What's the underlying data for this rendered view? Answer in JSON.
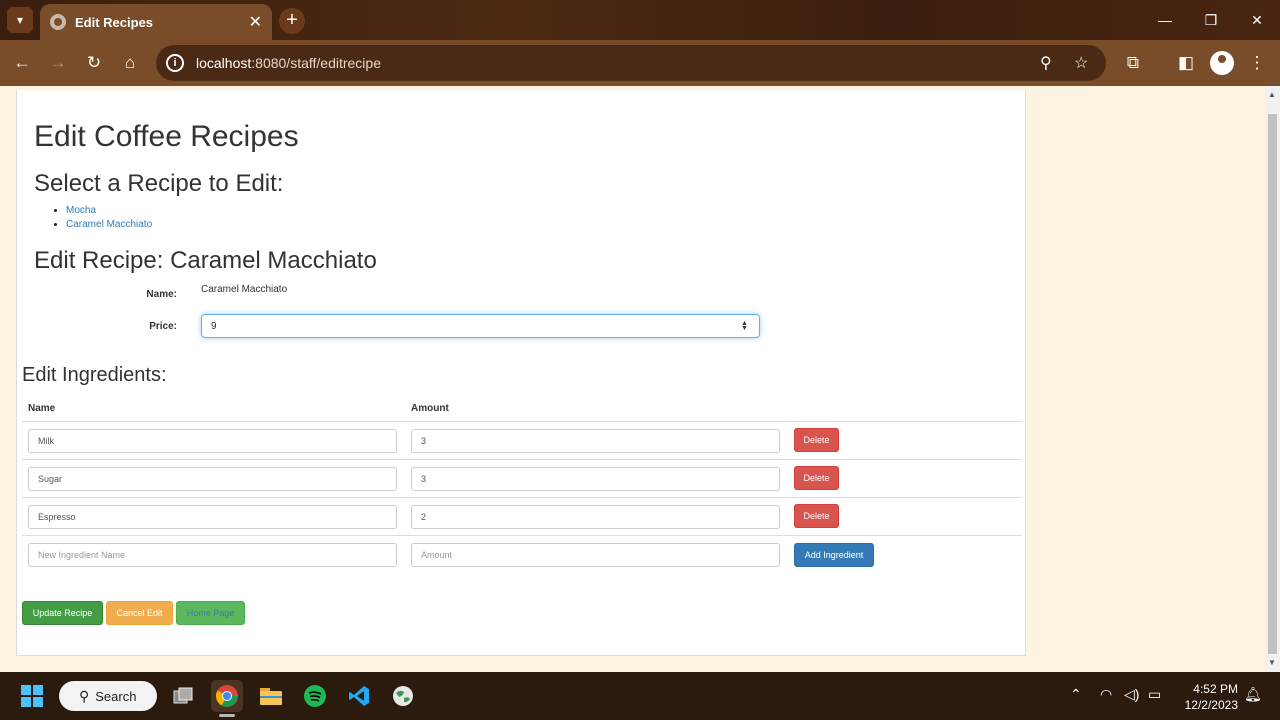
{
  "browser": {
    "tab_title": "Edit Recipes",
    "tab_close": "✕",
    "new_tab": "+",
    "url_host": "localhost",
    "url_path": ":8080/staff/editrecipe",
    "window_controls": {
      "minimize": "—",
      "restore": "❐",
      "close": "✕"
    }
  },
  "page": {
    "title": "Edit Coffee Recipes",
    "select_heading": "Select a Recipe to Edit:",
    "recipes": [
      "Mocha",
      "Caramel Macchiato"
    ],
    "edit_heading": "Edit Recipe: Caramel Macchiato",
    "form": {
      "name_label": "Name:",
      "name_value": "Caramel Macchiato",
      "price_label": "Price:",
      "price_value": "9"
    },
    "ingredients": {
      "heading": "Edit Ingredients:",
      "col_name": "Name",
      "col_amount": "Amount",
      "rows": [
        {
          "name": "Milk",
          "amount": "3",
          "action": "Delete"
        },
        {
          "name": "Sugar",
          "amount": "3",
          "action": "Delete"
        },
        {
          "name": "Espresso",
          "amount": "2",
          "action": "Delete"
        }
      ],
      "new_name_placeholder": "New Ingredient Name",
      "new_amount_placeholder": "Amount",
      "add_button": "Add Ingredient"
    },
    "buttons": {
      "update": "Update Recipe",
      "cancel": "Cancel Edit",
      "home": "Home Page"
    }
  },
  "taskbar": {
    "search_label": "Search",
    "time": "4:52 PM",
    "date": "12/2/2023"
  },
  "colors": {
    "danger": "#d9534f",
    "primary": "#337ab7",
    "success": "#449d44",
    "warning": "#f0ad4e",
    "chrome_brown": "#7a4d2a"
  }
}
